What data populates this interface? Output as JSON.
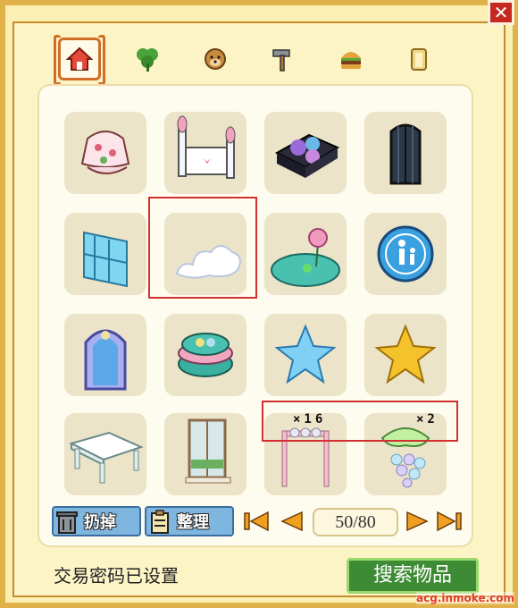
{
  "window": {
    "close_icon": "close-x-icon",
    "colors": {
      "frame": "#e2b24a",
      "panel": "#fefcee",
      "slot": "#ece4c8",
      "highlight": "#d23030",
      "search_button": "#3d8b35"
    }
  },
  "tabs": [
    {
      "icon": "house-icon",
      "active": true
    },
    {
      "icon": "clover-plant-icon",
      "active": false
    },
    {
      "icon": "dog-pet-icon",
      "active": false
    },
    {
      "icon": "hammer-tool-icon",
      "active": false
    },
    {
      "icon": "burger-food-icon",
      "active": false
    },
    {
      "icon": "door-item-icon",
      "active": false
    }
  ],
  "inventory": [
    {
      "icon": "flower-lamp-icon"
    },
    {
      "icon": "bunny-bed-icon"
    },
    {
      "icon": "purple-sofa-icon"
    },
    {
      "icon": "dark-window-icon"
    },
    {
      "icon": "ice-bookshelf-icon"
    },
    {
      "icon": "cloud-icon",
      "highlighted": true
    },
    {
      "icon": "lotus-pond-icon"
    },
    {
      "icon": "restroom-sign-icon"
    },
    {
      "icon": "arch-mirror-icon"
    },
    {
      "icon": "macaron-icon"
    },
    {
      "icon": "blue-star-icon"
    },
    {
      "icon": "gold-star-icon"
    },
    {
      "icon": "white-table-icon"
    },
    {
      "icon": "window-frame-icon"
    },
    {
      "icon": "pink-rack-icon",
      "quantity": "×16"
    },
    {
      "icon": "grape-lamp-icon",
      "quantity": "×2"
    }
  ],
  "toolbar": {
    "discard_label": "扔掉",
    "discard_icon": "trash-can-icon",
    "organize_label": "整理",
    "organize_icon": "clipboard-icon",
    "first_icon": "first-page-icon",
    "prev_icon": "prev-page-icon",
    "next_icon": "next-page-icon",
    "last_icon": "last-page-icon",
    "page_text": "50/80"
  },
  "footer": {
    "status_text": "交易密码已设置",
    "search_button_label": "搜索物品",
    "watermark": "acg.inmoke.com"
  }
}
